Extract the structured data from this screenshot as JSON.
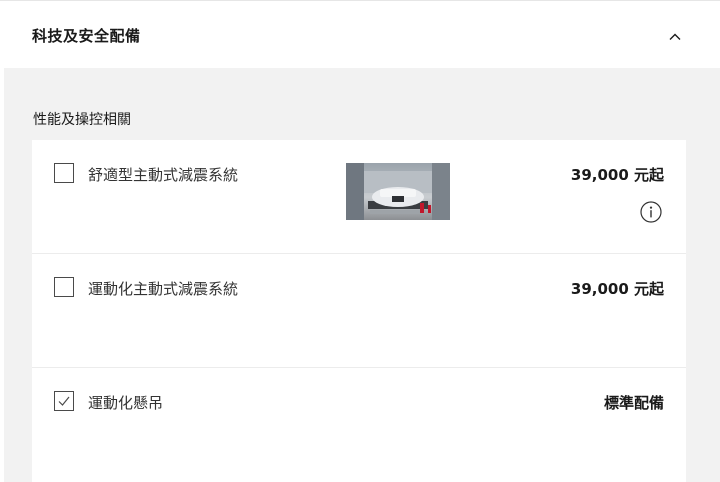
{
  "header": {
    "title": "科技及安全配備",
    "collapse_icon": "chevron-up-icon"
  },
  "section": {
    "title": "性能及操控相關"
  },
  "options": [
    {
      "label": "舒適型主動式減震系統",
      "price": "39,000 元起",
      "checked": false,
      "has_image": true,
      "has_info": true
    },
    {
      "label": "運動化主動式減震系統",
      "price": "39,000 元起",
      "checked": false,
      "has_image": false,
      "has_info": false
    },
    {
      "label": "運動化懸吊",
      "price": "標準配備",
      "checked": true,
      "has_image": false,
      "has_info": false
    }
  ],
  "colors": {
    "panel_bg": "#f2f2f2",
    "card_bg": "#ffffff",
    "text": "#1a1a1a",
    "accent_red": "#c0172b"
  }
}
